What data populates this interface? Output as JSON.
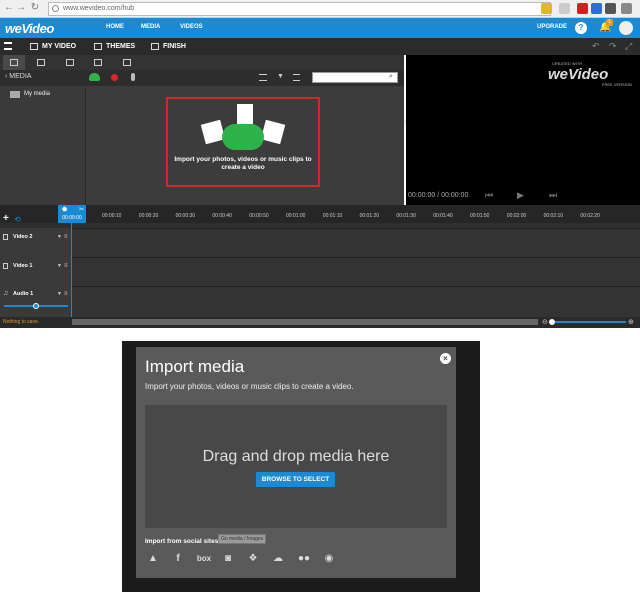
{
  "browser": {
    "url": "www.wevideo.com/hub"
  },
  "topnav": {
    "logo": "weVideo",
    "home": "HOME",
    "media": "MEDIA",
    "videos": "VIDEOS",
    "upgrade": "UPGRADE",
    "notif": "1"
  },
  "app": {
    "tabs": [
      "MY VIDEO",
      "THEMES",
      "FINISH"
    ]
  },
  "media": {
    "back_label": "MEDIA",
    "folder": "My media",
    "drop_text": "Import your photos, videos or music clips to create a video"
  },
  "preview": {
    "time": "00:00:00 / 00:00:00",
    "brand_small": "CREATED WITH",
    "brand": "weVideo",
    "brand_sub": "FREE VERSION"
  },
  "timeline": {
    "playhead": "00:00:00",
    "ticks": [
      "00:00:10",
      "00:00:20",
      "00:00:30",
      "00:00:40",
      "00:00:50",
      "00:01:00",
      "00:01:10",
      "00:01:20",
      "00:01:30",
      "00:01:40",
      "00:01:50",
      "00:02:00",
      "00:02:10",
      "00:02:20"
    ],
    "tracks": [
      "Video 2",
      "Video 1",
      "Audio 1"
    ]
  },
  "status": {
    "text": "Nothing to save."
  },
  "modal": {
    "title": "Import media",
    "subtitle": "Import your photos, videos or music clips to create a video.",
    "drop": "Drag and drop media here",
    "browse": "BROWSE TO SELECT",
    "social_title": "Import from social sites:",
    "tooltip": "Go media / Images",
    "social": [
      "drive-icon",
      "facebook-icon",
      "box-icon",
      "instagram-icon",
      "dropbox-icon",
      "onedrive-icon",
      "flickr-icon",
      "picasa-icon"
    ]
  }
}
